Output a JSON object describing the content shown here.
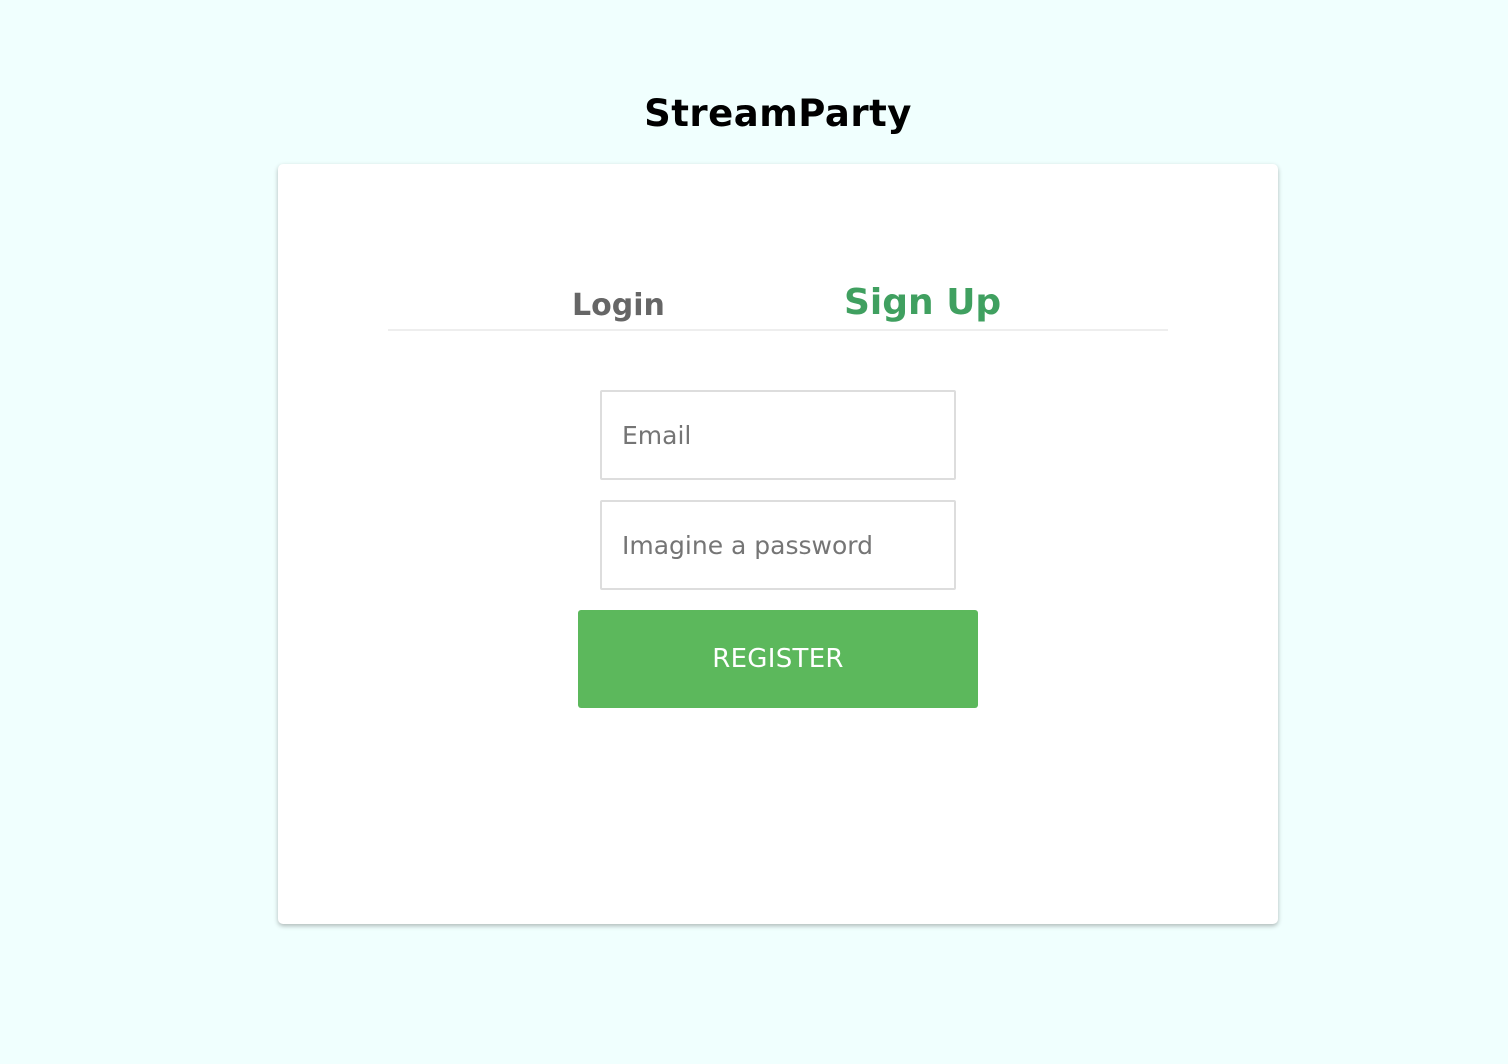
{
  "app": {
    "title": "StreamParty"
  },
  "tabs": {
    "login_label": "Login",
    "signup_label": "Sign Up",
    "active": "signup"
  },
  "form": {
    "email_placeholder": "Email",
    "password_placeholder": "Imagine a password",
    "email_value": "",
    "password_value": "",
    "submit_label": "REGISTER"
  },
  "colors": {
    "background": "#f0fffe",
    "accent_tab": "#40a060",
    "button": "#5cb85c",
    "inactive_tab": "#666666"
  }
}
